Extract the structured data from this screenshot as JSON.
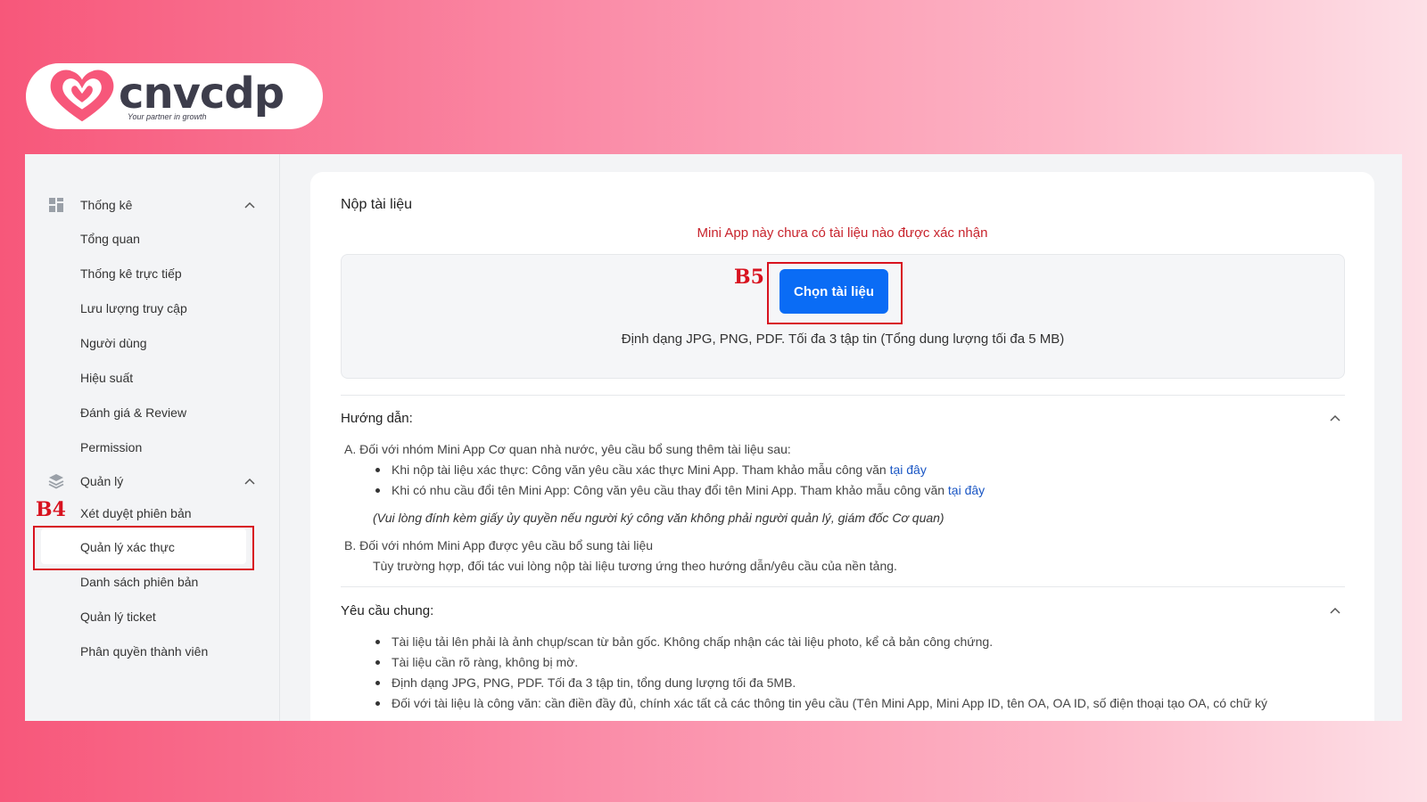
{
  "logo": {
    "word": "cnvcdp",
    "tagline": "Your partner in growth",
    "heart_color": "#f7577a"
  },
  "annotations": {
    "b4": "B4",
    "b5": "B5",
    "color": "#d8121f"
  },
  "sidebar": {
    "groups": [
      {
        "label": "Thống kê",
        "icon": "dashboard-icon"
      },
      {
        "label": "Quản lý",
        "icon": "layers-icon"
      }
    ],
    "stats_items": [
      "Tổng quan",
      "Thống kê trực tiếp",
      "Lưu lượng truy cập",
      "Người dùng",
      "Hiệu suất",
      "Đánh giá & Review",
      "Permission"
    ],
    "manage_items": [
      "Xét duyệt phiên bản",
      "Quản lý xác thực",
      "Danh sách phiên bản",
      "Quản lý ticket",
      "Phân quyền thành viên"
    ],
    "active_item": "Quản lý xác thực"
  },
  "main": {
    "title": "Nộp tài liệu",
    "warning": "Mini App này chưa có tài liệu nào được xác nhận",
    "choose_button": "Chọn tài liệu",
    "upload_hint": "Định dạng JPG, PNG, PDF. Tối đa 3 tập tin (Tổng dung lượng tối đa 5 MB)",
    "guide": {
      "heading": "Hướng dẫn:",
      "a_title": "A. Đối với nhóm Mini App Cơ quan nhà nước, yêu cầu bổ sung thêm tài liệu sau:",
      "a_b1": "Khi nộp tài liệu xác thực: Công văn yêu cầu xác thực Mini App. Tham khảo mẫu công văn ",
      "a_b1_link": "tại đây",
      "a_b2": "Khi có nhu cầu đổi tên Mini App: Công văn yêu cầu thay đổi tên Mini App. Tham khảo mẫu công văn ",
      "a_b2_link": "tại đây",
      "a_note": "(Vui lòng đính kèm giấy ủy quyền nếu người ký công văn không phải người quản lý, giám đốc Cơ quan)",
      "b_title": "B. Đối với nhóm Mini App được yêu cầu bổ sung tài liệu",
      "b_text": "Tùy trường hợp, đối tác vui lòng nộp tài liệu tương ứng theo hướng dẫn/yêu cầu của nền tảng."
    },
    "requirements": {
      "heading": "Yêu cầu chung:",
      "items": [
        "Tài liệu tải lên phải là ảnh chụp/scan từ bản gốc. Không chấp nhận các tài liệu photo, kể cả bản công chứng.",
        "Tài liệu cần rõ ràng, không bị mờ.",
        "Định dạng JPG, PNG, PDF. Tối đa 3 tập tin, tổng dung lượng tối đa 5MB.",
        "Đối với tài liệu là công văn: cần điền đầy đủ, chính xác tất cả các thông tin yêu cầu (Tên Mini App, Mini App ID, tên OA, OA ID, số điện thoại tạo OA, có chữ ký"
      ]
    }
  }
}
